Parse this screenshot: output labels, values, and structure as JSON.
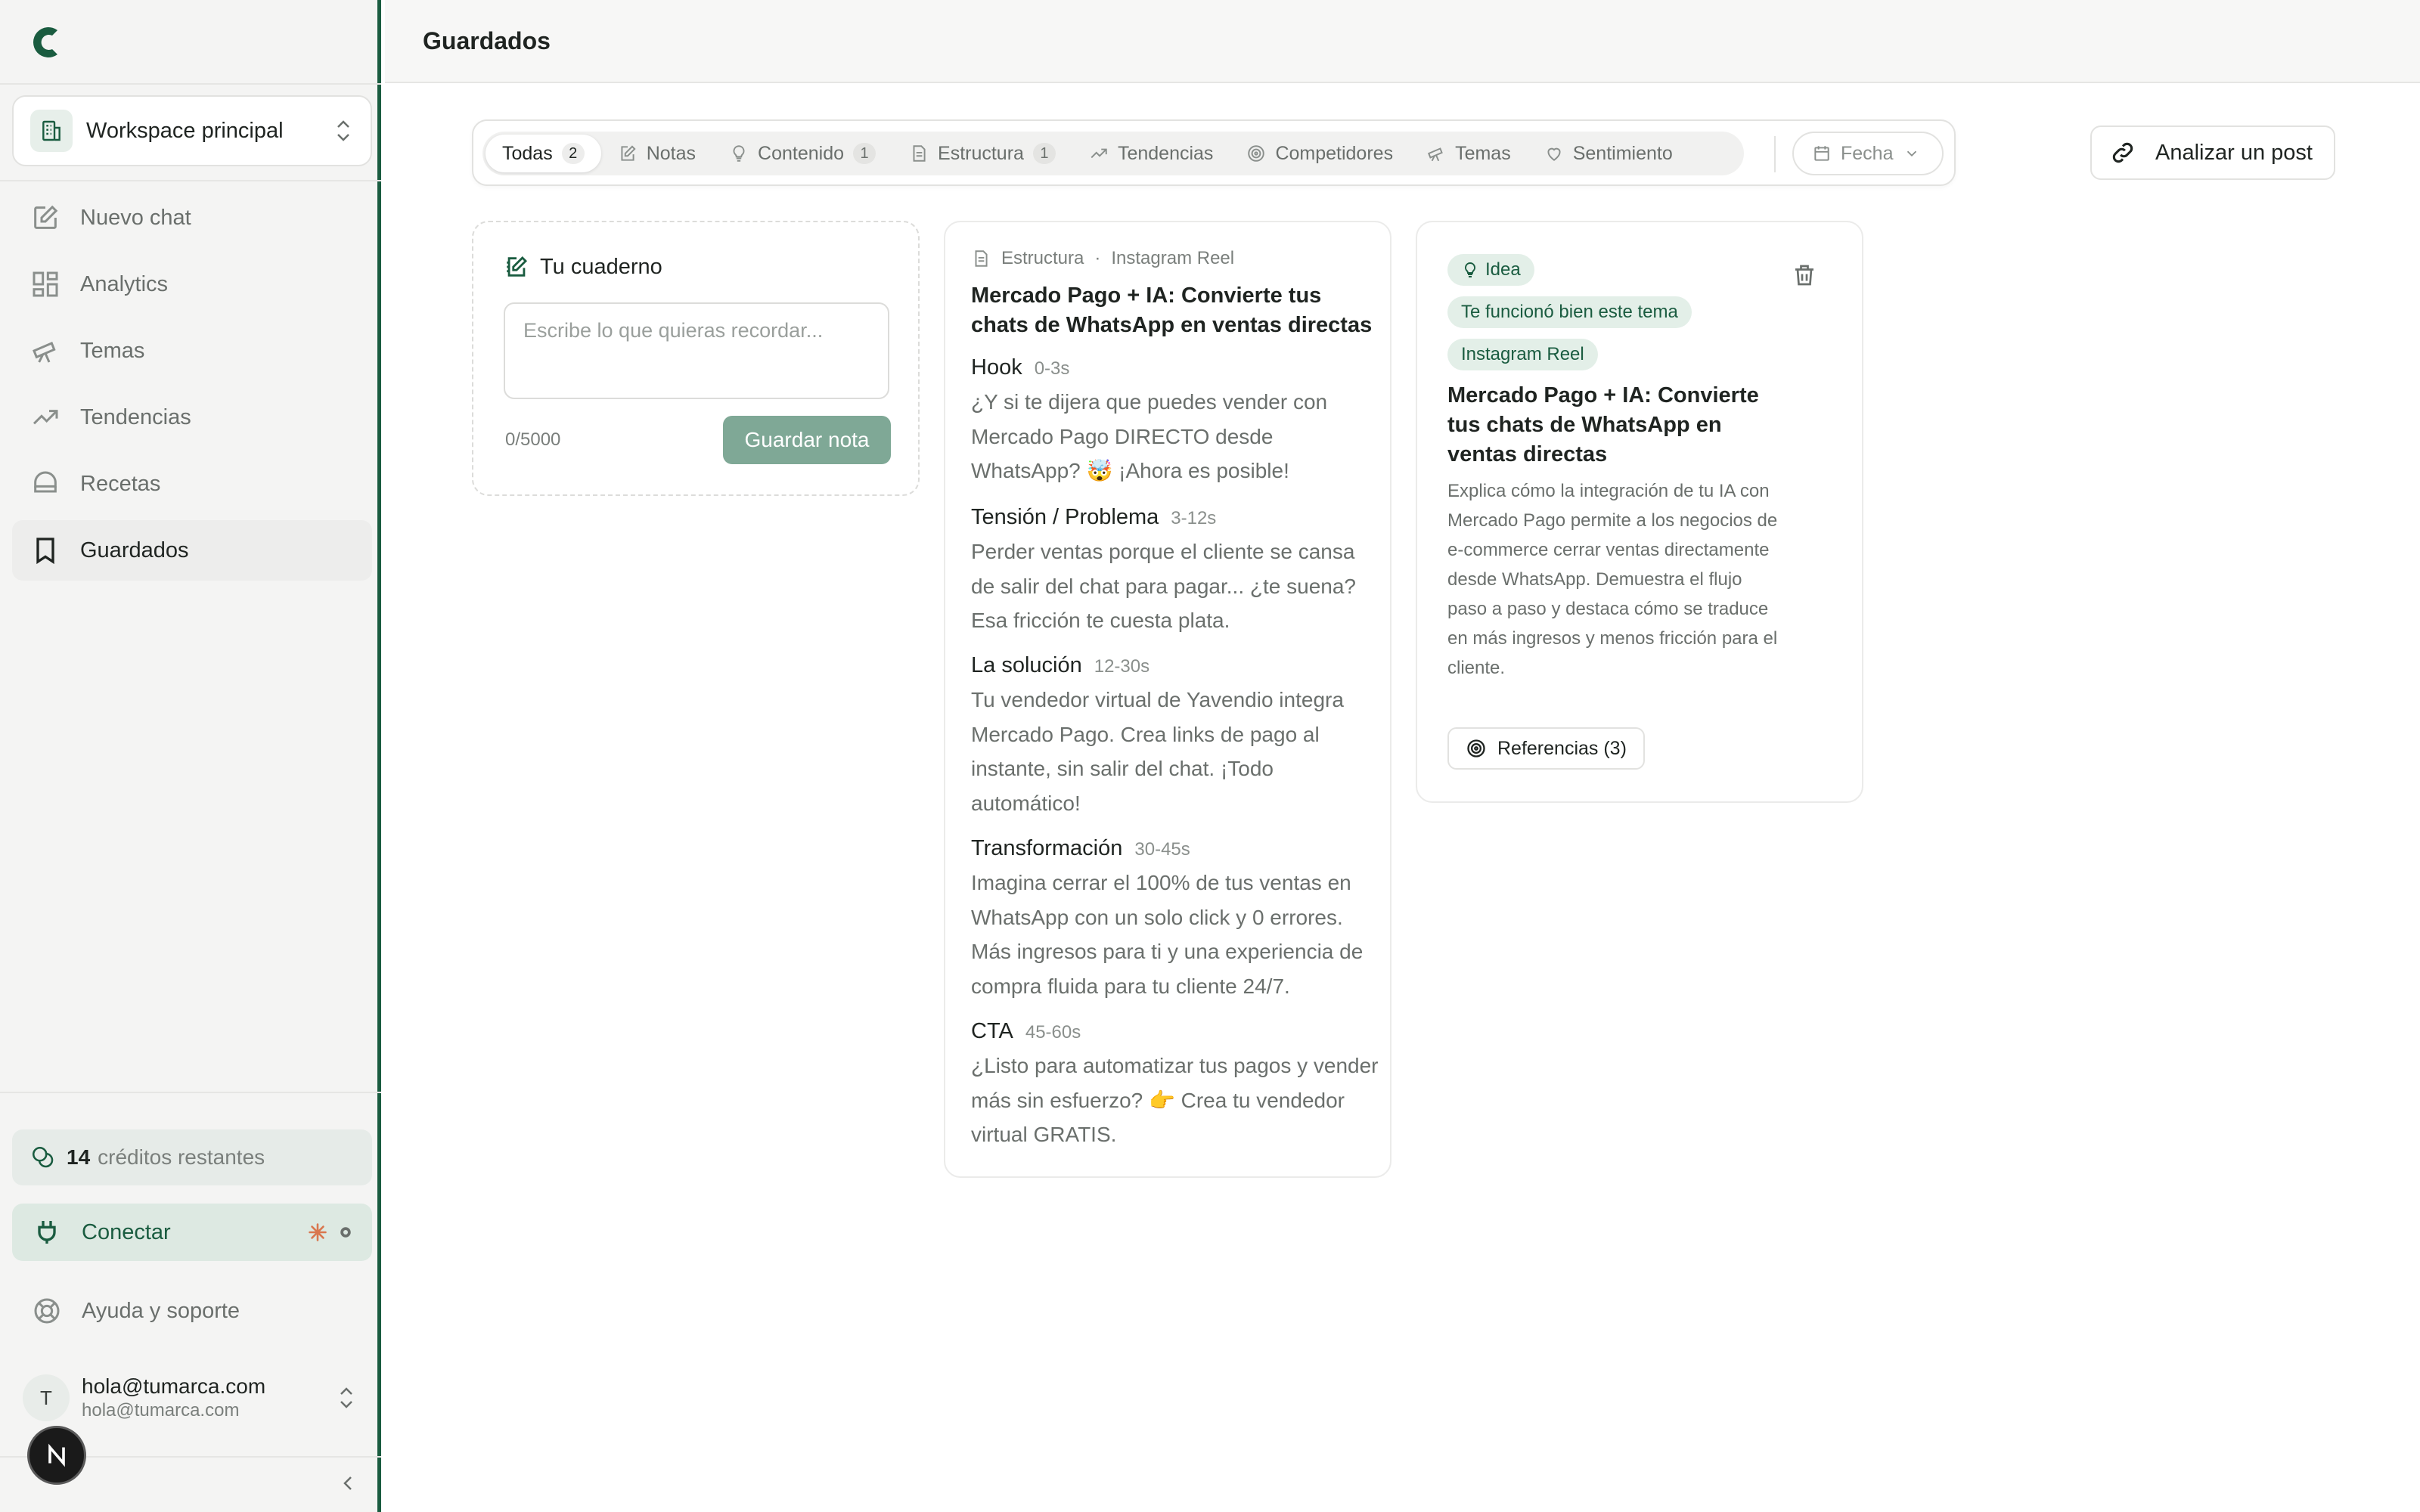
{
  "colors": {
    "brand": "#1a5c40",
    "accent_light": "#e3efe8",
    "save_button": "#7fa896"
  },
  "sidebar": {
    "logo_icon": "brand-c-logo",
    "workspace": {
      "label": "Workspace principal"
    },
    "items": [
      {
        "label": "Nuevo chat",
        "icon": "edit-icon"
      },
      {
        "label": "Analytics",
        "icon": "grid-icon"
      },
      {
        "label": "Temas",
        "icon": "telescope-icon"
      },
      {
        "label": "Tendencias",
        "icon": "trend-icon"
      },
      {
        "label": "Recetas",
        "icon": "chef-hat-icon"
      },
      {
        "label": "Guardados",
        "icon": "bookmark-icon",
        "active": true
      }
    ],
    "credits": {
      "count": "14",
      "label": "créditos restantes"
    },
    "connect": {
      "label": "Conectar"
    },
    "help": {
      "label": "Ayuda y soporte"
    },
    "user": {
      "initial": "T",
      "name": "hola@tumarca.com",
      "email": "hola@tumarca.com"
    }
  },
  "header": {
    "title": "Guardados"
  },
  "filters": {
    "tabs": [
      {
        "label": "Todas",
        "count": "2",
        "active": true
      },
      {
        "label": "Notas",
        "icon": "note-icon"
      },
      {
        "label": "Contenido",
        "count": "1",
        "icon": "lightbulb-icon"
      },
      {
        "label": "Estructura",
        "count": "1",
        "icon": "document-icon"
      },
      {
        "label": "Tendencias",
        "icon": "trend-icon"
      },
      {
        "label": "Competidores",
        "icon": "target-icon"
      },
      {
        "label": "Temas",
        "icon": "telescope-icon"
      },
      {
        "label": "Sentimiento",
        "icon": "heart-icon"
      }
    ],
    "date": {
      "label": "Fecha"
    }
  },
  "analyze_button": {
    "label": "Analizar un post"
  },
  "notebook": {
    "title": "Tu cuaderno",
    "placeholder": "Escribe lo que quieras recordar...",
    "counter": "0/5000",
    "save_label": "Guardar nota"
  },
  "structure_card": {
    "type": "Estructura",
    "format": "Instagram Reel",
    "title": "Mercado Pago + IA: Convierte tus chats de WhatsApp en ventas directas",
    "sections": [
      {
        "name": "Hook",
        "time": "0-3s",
        "text": "¿Y si te dijera que puedes vender con Mercado Pago DIRECTO desde WhatsApp? 🤯 ¡Ahora es posible!"
      },
      {
        "name": "Tensión / Problema",
        "time": "3-12s",
        "text": "Perder ventas porque el cliente se cansa de salir del chat para pagar... ¿te suena? Esa fricción te cuesta plata."
      },
      {
        "name": "La solución",
        "time": "12-30s",
        "text": "Tu vendedor virtual de Yavendio integra Mercado Pago. Crea links de pago al instante, sin salir del chat. ¡Todo automático!"
      },
      {
        "name": "Transformación",
        "time": "30-45s",
        "text": "Imagina cerrar el 100% de tus ventas en WhatsApp con un solo click y 0 errores. Más ingresos para ti y una experiencia de compra fluida para tu cliente 24/7."
      },
      {
        "name": "CTA",
        "time": "45-60s",
        "text": "¿Listo para automatizar tus pagos y vender más sin esfuerzo? 👉 Crea tu vendedor virtual GRATIS."
      }
    ]
  },
  "idea_card": {
    "tag": "Idea",
    "badge": "Te funcionó bien este tema",
    "format": "Instagram Reel",
    "title": "Mercado Pago + IA: Convierte tus chats de WhatsApp en ventas directas",
    "description": "Explica cómo la integración de tu IA con Mercado Pago permite a los negocios de e-commerce cerrar ventas directamente desde WhatsApp. Demuestra el flujo paso a paso y destaca cómo se traduce en más ingresos y menos fricción para el cliente.",
    "references_label": "Referencias (3)"
  }
}
